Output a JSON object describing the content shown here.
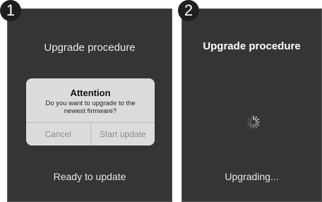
{
  "steps": [
    {
      "badge": "1",
      "title": "Upgrade procedure",
      "status": "Ready to update",
      "dialog": {
        "title": "Attention",
        "message_line1": "Do you want to upgrade to the",
        "message_line2": "newest firmware?",
        "cancel_label": "Cancel",
        "confirm_label": "Start update"
      }
    },
    {
      "badge": "2",
      "title": "Upgrade procedure",
      "status": "Upgrading...",
      "spinner_icon": "loading-spinner-icon"
    }
  ],
  "colors": {
    "screen_background": "#353535",
    "dialog_background": "#dcdcdc",
    "badge_background": "#1f1f1f"
  }
}
